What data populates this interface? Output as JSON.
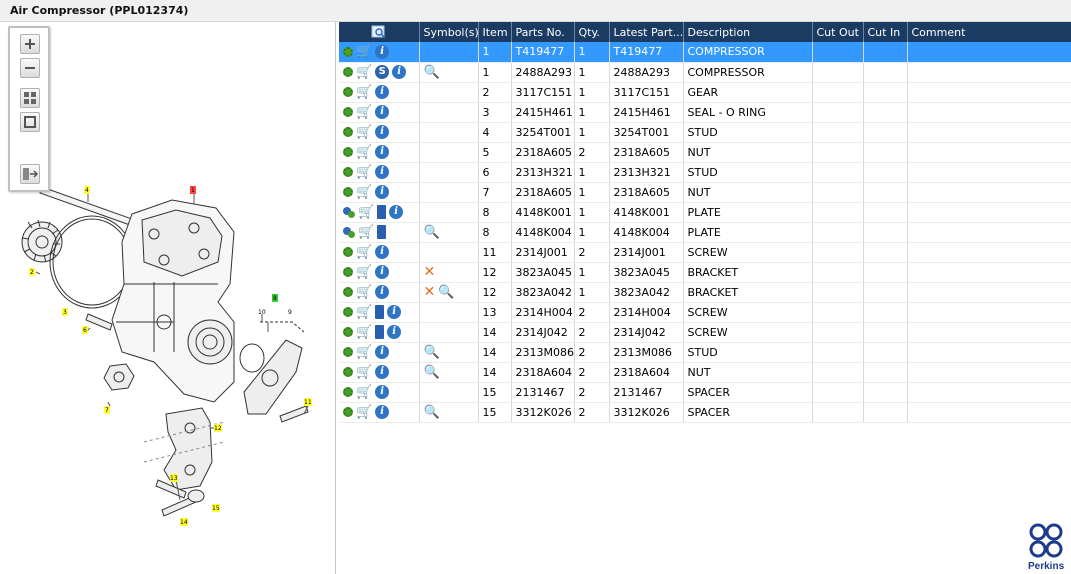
{
  "window": {
    "title": "Air Compressor (PPL012374)"
  },
  "toolbar": {
    "buttons": [
      "zoom-in",
      "zoom-out",
      "fit-all",
      "fit-window",
      "export"
    ]
  },
  "diagram": {
    "callouts": [
      "4",
      "1",
      "2",
      "3",
      "6",
      "8",
      "10",
      "9",
      "7",
      "11",
      "12",
      "13",
      "15",
      "14"
    ]
  },
  "grid": {
    "columns": [
      "",
      "Symbol(s)",
      "Item",
      "Parts No.",
      "Qty.",
      "Latest Part...",
      "Description",
      "Cut Out",
      "Cut In",
      "Comment"
    ],
    "rows": [
      {
        "icons": [
          "gear",
          "cart",
          "info"
        ],
        "symbols": [],
        "item": "1",
        "part": "T419477",
        "qty": "1",
        "latest": "T419477",
        "desc": "COMPRESSOR",
        "selected": true
      },
      {
        "icons": [
          "gear",
          "cart",
          "s",
          "info"
        ],
        "symbols": [
          "mag"
        ],
        "item": "1",
        "part": "2488A293",
        "qty": "1",
        "latest": "2488A293",
        "desc": "COMPRESSOR"
      },
      {
        "icons": [
          "gear",
          "cart",
          "info"
        ],
        "symbols": [],
        "item": "2",
        "part": "3117C151",
        "qty": "1",
        "latest": "3117C151",
        "desc": "GEAR"
      },
      {
        "icons": [
          "gear",
          "cart",
          "info"
        ],
        "symbols": [],
        "item": "3",
        "part": "2415H461",
        "qty": "1",
        "latest": "2415H461",
        "desc": "SEAL - O RING"
      },
      {
        "icons": [
          "gear",
          "cart",
          "info"
        ],
        "symbols": [],
        "item": "4",
        "part": "3254T001",
        "qty": "1",
        "latest": "3254T001",
        "desc": "STUD"
      },
      {
        "icons": [
          "gear",
          "cart",
          "info"
        ],
        "symbols": [],
        "item": "5",
        "part": "2318A605",
        "qty": "2",
        "latest": "2318A605",
        "desc": "NUT"
      },
      {
        "icons": [
          "gear",
          "cart",
          "info"
        ],
        "symbols": [],
        "item": "6",
        "part": "2313H321",
        "qty": "1",
        "latest": "2313H321",
        "desc": "STUD"
      },
      {
        "icons": [
          "gear",
          "cart",
          "info"
        ],
        "symbols": [],
        "item": "7",
        "part": "2318A605",
        "qty": "1",
        "latest": "2318A605",
        "desc": "NUT"
      },
      {
        "icons": [
          "gear2",
          "cart",
          "book",
          "info"
        ],
        "symbols": [],
        "item": "8",
        "part": "4148K001",
        "qty": "1",
        "latest": "4148K001",
        "desc": "PLATE"
      },
      {
        "icons": [
          "gear2",
          "cart",
          "book"
        ],
        "symbols": [
          "mag"
        ],
        "item": "8",
        "part": "4148K004",
        "qty": "1",
        "latest": "4148K004",
        "desc": "PLATE"
      },
      {
        "icons": [
          "gear",
          "cart",
          "info"
        ],
        "symbols": [],
        "item": "11",
        "part": "2314J001",
        "qty": "2",
        "latest": "2314J001",
        "desc": "SCREW"
      },
      {
        "icons": [
          "gear",
          "cart",
          "info"
        ],
        "symbols": [
          "x"
        ],
        "item": "12",
        "part": "3823A045",
        "qty": "1",
        "latest": "3823A045",
        "desc": "BRACKET"
      },
      {
        "icons": [
          "gear",
          "cart",
          "info"
        ],
        "symbols": [
          "x",
          "mag"
        ],
        "item": "12",
        "part": "3823A042",
        "qty": "1",
        "latest": "3823A042",
        "desc": "BRACKET"
      },
      {
        "icons": [
          "gear",
          "cart",
          "book",
          "info"
        ],
        "symbols": [],
        "item": "13",
        "part": "2314H004",
        "qty": "2",
        "latest": "2314H004",
        "desc": "SCREW"
      },
      {
        "icons": [
          "gear",
          "cart",
          "book",
          "info"
        ],
        "symbols": [],
        "item": "14",
        "part": "2314J042",
        "qty": "2",
        "latest": "2314J042",
        "desc": "SCREW"
      },
      {
        "icons": [
          "gear",
          "cart",
          "info"
        ],
        "symbols": [
          "mag"
        ],
        "item": "14",
        "part": "2313M086",
        "qty": "2",
        "latest": "2313M086",
        "desc": "STUD"
      },
      {
        "icons": [
          "gear",
          "cart",
          "info"
        ],
        "symbols": [
          "mag"
        ],
        "item": "14",
        "part": "2318A604",
        "qty": "2",
        "latest": "2318A604",
        "desc": "NUT"
      },
      {
        "icons": [
          "gear",
          "cart",
          "info"
        ],
        "symbols": [],
        "item": "15",
        "part": "2131467",
        "qty": "2",
        "latest": "2131467",
        "desc": "SPACER"
      },
      {
        "icons": [
          "gear",
          "cart",
          "info"
        ],
        "symbols": [
          "mag"
        ],
        "item": "15",
        "part": "3312K026",
        "qty": "2",
        "latest": "3312K026",
        "desc": "SPACER"
      }
    ]
  },
  "brand": {
    "name": "Perkins",
    "color": "#1c3b8c"
  },
  "colors": {
    "header": "#1c3b63",
    "selection": "#3399ff",
    "callout": "#ffff33"
  }
}
